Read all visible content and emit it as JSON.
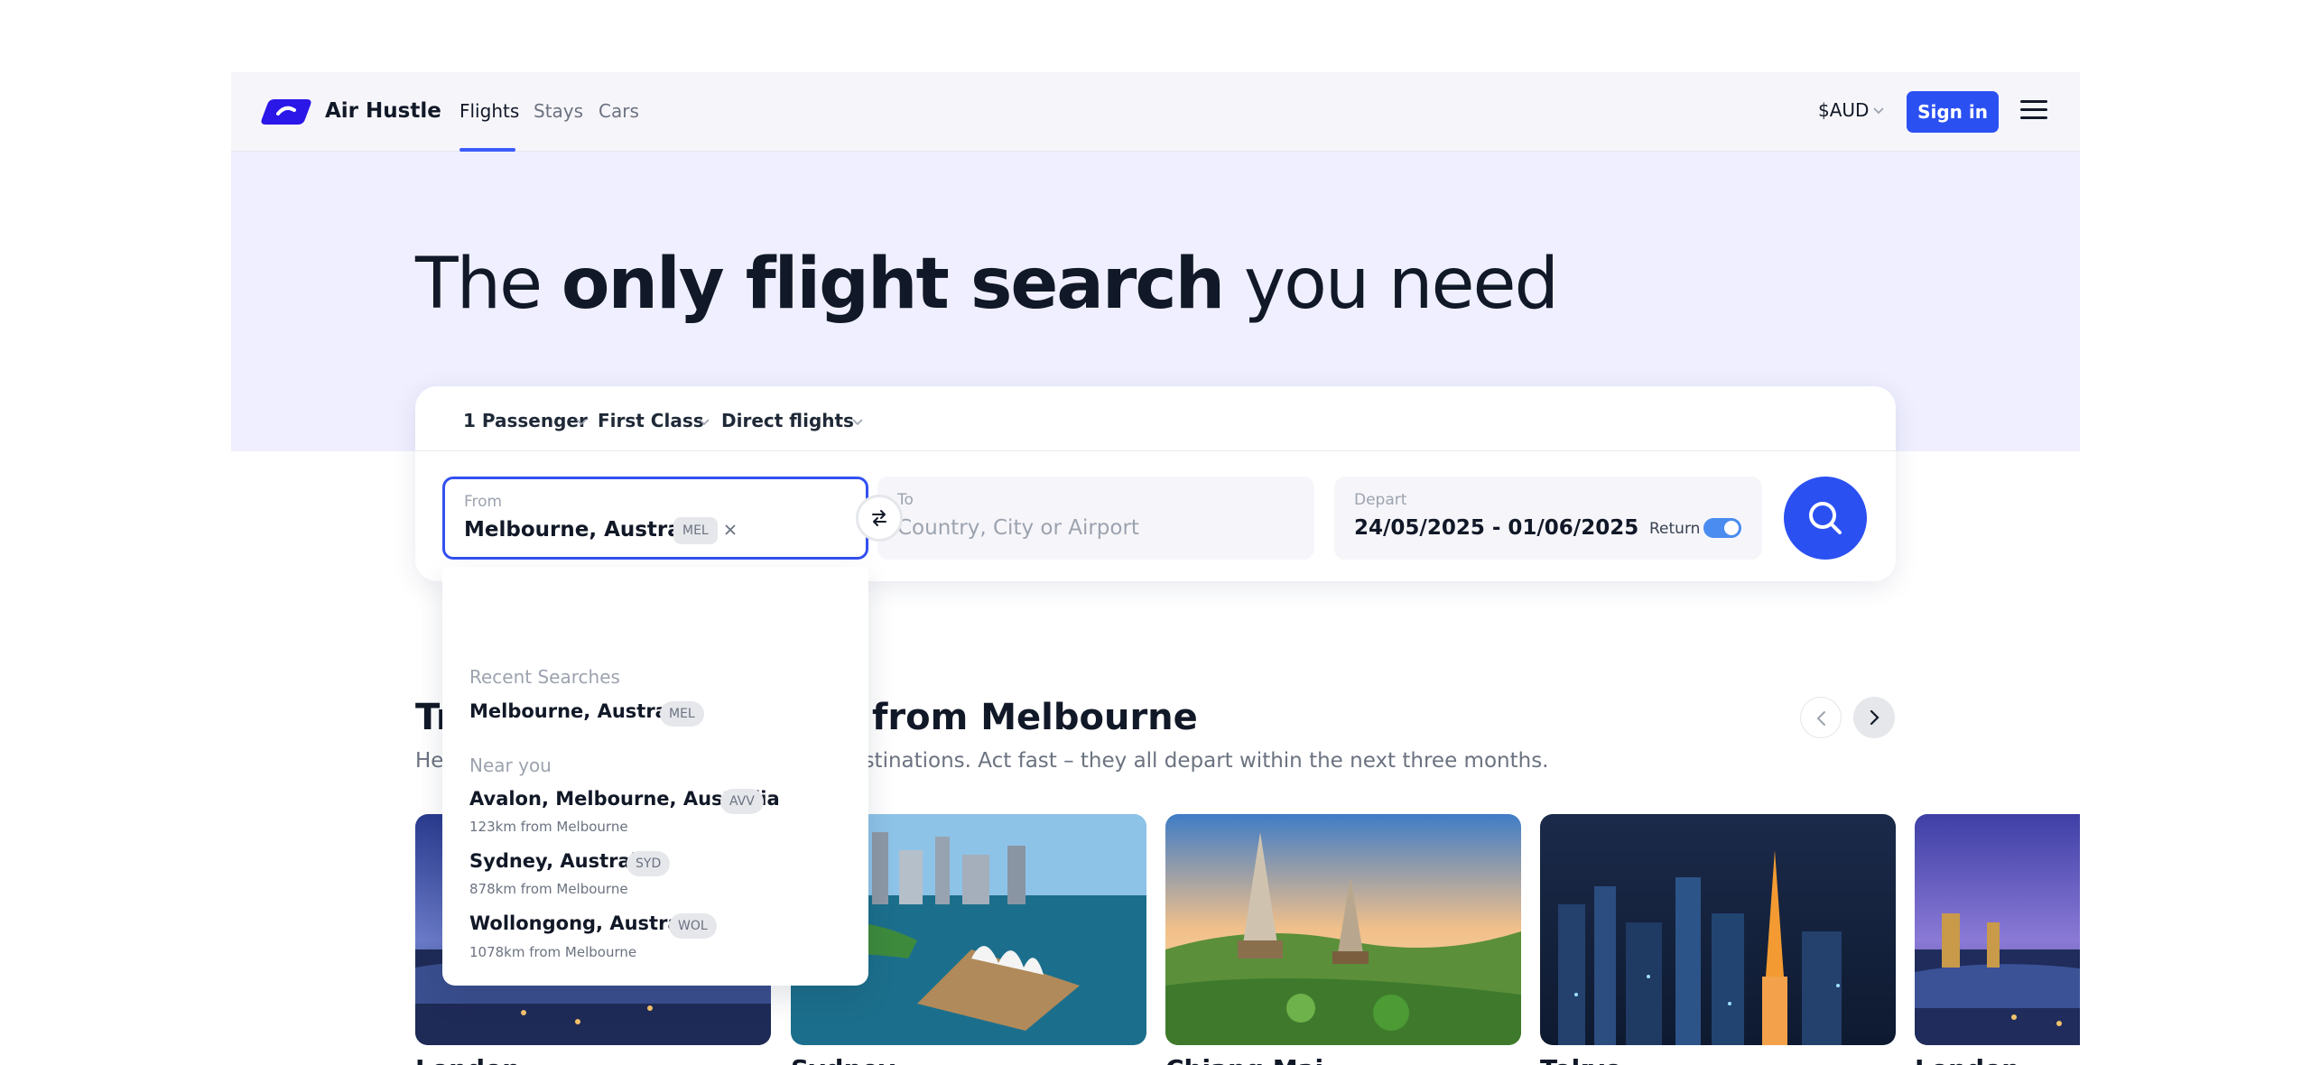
{
  "brand": {
    "name": "Air Hustle",
    "logo_icon": "air-hustle-logo",
    "color": "#2b17e8"
  },
  "nav": {
    "links": [
      {
        "label": "Flights",
        "active": true
      },
      {
        "label": "Stays",
        "active": false
      },
      {
        "label": "Cars",
        "active": false
      }
    ],
    "currency": "$AUD",
    "signin_label": "Sign in",
    "menu_icon": "hamburger-menu-icon"
  },
  "hero": {
    "title_part1": "The ",
    "title_bold": "only flight search",
    "title_part2": " you need"
  },
  "search": {
    "options": {
      "passengers": "1 Passenger",
      "cabin_class": "First Class",
      "stops": "Direct flights"
    },
    "from": {
      "label": "From",
      "value": "Melbourne, Australia",
      "code": "MEL"
    },
    "to": {
      "label": "To",
      "placeholder": "Country, City or Airport"
    },
    "depart": {
      "label": "Depart",
      "value": "24/05/2025 - 01/06/2025",
      "return_label": "Return",
      "return_enabled": true
    },
    "accent_color": "#2b50f2"
  },
  "dropdown": {
    "recent_heading": "Recent Searches",
    "recent": [
      {
        "name": "Melbourne, Australia",
        "code": "MEL"
      }
    ],
    "near_heading": "Near you",
    "near": [
      {
        "name": "Avalon, Melbourne, Australia",
        "code": "AVV",
        "distance": "123km from Melbourne"
      },
      {
        "name": "Sydney, Australia",
        "code": "SYD",
        "distance": "878km from Melbourne"
      },
      {
        "name": "Wollongong, Australia",
        "code": "WOL",
        "distance": "1078km from Melbourne"
      }
    ]
  },
  "trending": {
    "title": "Trending destinations from Melbourne",
    "subtitle": "Here are the cheapest flights to popular destinations. Act fast – they all depart within the next three months.",
    "prev_icon": "chevron-left-icon",
    "next_icon": "chevron-right-icon",
    "cards": [
      {
        "name": "London"
      },
      {
        "name": "Sydney"
      },
      {
        "name": "Chiang Mai"
      },
      {
        "name": "Tokyo"
      },
      {
        "name": "London"
      }
    ]
  }
}
